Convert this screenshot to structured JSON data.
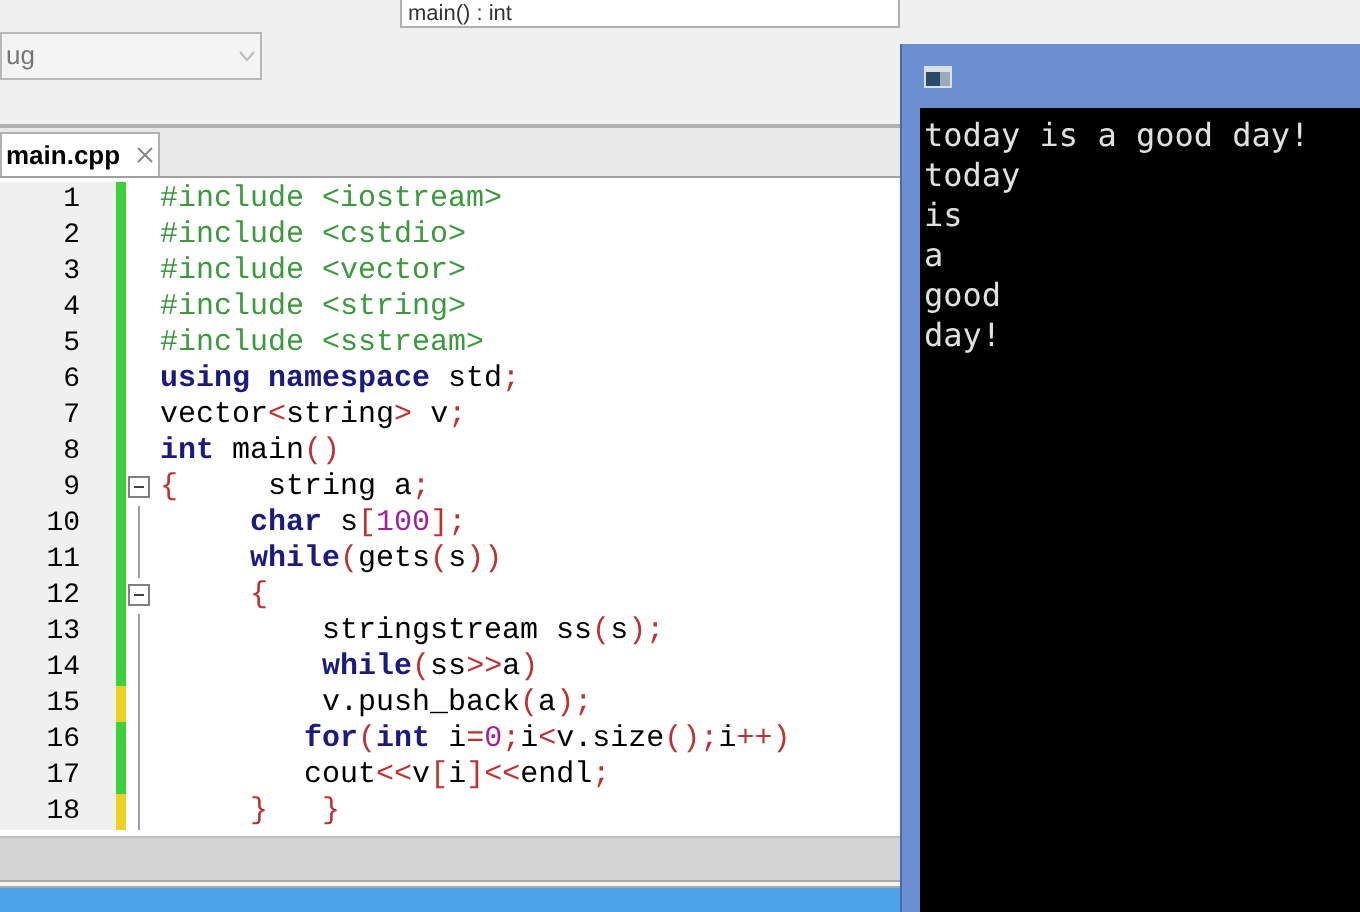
{
  "toolbar": {
    "build_target": "ug",
    "function_scope": "main() : int"
  },
  "tabs": [
    {
      "label": "main.cpp",
      "selected": true
    }
  ],
  "editor": {
    "lines": [
      {
        "number": "1",
        "unsaved": false,
        "fold_toggle": false,
        "in_fold": false,
        "tokens": [
          {
            "kind": "pp",
            "text": "#include <iostream>"
          }
        ]
      },
      {
        "number": "2",
        "unsaved": false,
        "fold_toggle": false,
        "in_fold": false,
        "tokens": [
          {
            "kind": "pp",
            "text": "#include <cstdio>"
          }
        ]
      },
      {
        "number": "3",
        "unsaved": false,
        "fold_toggle": false,
        "in_fold": false,
        "tokens": [
          {
            "kind": "pp",
            "text": "#include <vector>"
          }
        ]
      },
      {
        "number": "4",
        "unsaved": false,
        "fold_toggle": false,
        "in_fold": false,
        "tokens": [
          {
            "kind": "pp",
            "text": "#include <string>"
          }
        ]
      },
      {
        "number": "5",
        "unsaved": false,
        "fold_toggle": false,
        "in_fold": false,
        "tokens": [
          {
            "kind": "pp",
            "text": "#include <sstream>"
          }
        ]
      },
      {
        "number": "6",
        "unsaved": false,
        "fold_toggle": false,
        "in_fold": false,
        "tokens": [
          {
            "kind": "kw",
            "text": "using namespace"
          },
          {
            "kind": "plain",
            "text": " std"
          },
          {
            "kind": "op",
            "text": ";"
          }
        ]
      },
      {
        "number": "7",
        "unsaved": false,
        "fold_toggle": false,
        "in_fold": false,
        "tokens": [
          {
            "kind": "plain",
            "text": "vector"
          },
          {
            "kind": "op",
            "text": "<"
          },
          {
            "kind": "plain",
            "text": "string"
          },
          {
            "kind": "op",
            "text": ">"
          },
          {
            "kind": "plain",
            "text": " v"
          },
          {
            "kind": "op",
            "text": ";"
          }
        ]
      },
      {
        "number": "8",
        "unsaved": false,
        "fold_toggle": false,
        "in_fold": false,
        "tokens": [
          {
            "kind": "kw",
            "text": "int"
          },
          {
            "kind": "plain",
            "text": " main"
          },
          {
            "kind": "op",
            "text": "()"
          }
        ]
      },
      {
        "number": "9",
        "unsaved": false,
        "fold_toggle": true,
        "tokens": [
          {
            "kind": "op",
            "text": "{"
          },
          {
            "kind": "plain",
            "text": "     string a"
          },
          {
            "kind": "op",
            "text": ";"
          }
        ]
      },
      {
        "number": "10",
        "unsaved": false,
        "fold_toggle": false,
        "in_fold": true,
        "tokens": [
          {
            "kind": "kw",
            "text": "     char"
          },
          {
            "kind": "plain",
            "text": " s"
          },
          {
            "kind": "op",
            "text": "["
          },
          {
            "kind": "num",
            "text": "100"
          },
          {
            "kind": "op",
            "text": "];"
          }
        ]
      },
      {
        "number": "11",
        "unsaved": false,
        "fold_toggle": false,
        "in_fold": true,
        "tokens": [
          {
            "kind": "kw",
            "text": "     while"
          },
          {
            "kind": "op",
            "text": "("
          },
          {
            "kind": "plain",
            "text": "gets"
          },
          {
            "kind": "op",
            "text": "("
          },
          {
            "kind": "plain",
            "text": "s"
          },
          {
            "kind": "op",
            "text": "))"
          }
        ]
      },
      {
        "number": "12",
        "unsaved": false,
        "fold_toggle": true,
        "tokens": [
          {
            "kind": "op",
            "text": "     {"
          }
        ]
      },
      {
        "number": "13",
        "unsaved": false,
        "fold_toggle": false,
        "in_fold": true,
        "tokens": [
          {
            "kind": "plain",
            "text": "         stringstream ss"
          },
          {
            "kind": "op",
            "text": "("
          },
          {
            "kind": "plain",
            "text": "s"
          },
          {
            "kind": "op",
            "text": ");"
          }
        ]
      },
      {
        "number": "14",
        "unsaved": false,
        "fold_toggle": false,
        "in_fold": true,
        "tokens": [
          {
            "kind": "kw",
            "text": "         while"
          },
          {
            "kind": "op",
            "text": "("
          },
          {
            "kind": "plain",
            "text": "ss"
          },
          {
            "kind": "op",
            "text": ">>"
          },
          {
            "kind": "plain",
            "text": "a"
          },
          {
            "kind": "op",
            "text": ")"
          }
        ]
      },
      {
        "number": "15",
        "unsaved": true,
        "fold_toggle": false,
        "in_fold": true,
        "tokens": [
          {
            "kind": "plain",
            "text": "         v.push_back"
          },
          {
            "kind": "op",
            "text": "("
          },
          {
            "kind": "plain",
            "text": "a"
          },
          {
            "kind": "op",
            "text": ");"
          }
        ]
      },
      {
        "number": "16",
        "unsaved": false,
        "fold_toggle": false,
        "in_fold": true,
        "tokens": [
          {
            "kind": "kw",
            "text": "        for"
          },
          {
            "kind": "op",
            "text": "("
          },
          {
            "kind": "kw",
            "text": "int"
          },
          {
            "kind": "plain",
            "text": " i"
          },
          {
            "kind": "op",
            "text": "="
          },
          {
            "kind": "num",
            "text": "0"
          },
          {
            "kind": "op",
            "text": ";"
          },
          {
            "kind": "plain",
            "text": "i"
          },
          {
            "kind": "op",
            "text": "<"
          },
          {
            "kind": "plain",
            "text": "v.size"
          },
          {
            "kind": "op",
            "text": "();"
          },
          {
            "kind": "plain",
            "text": "i"
          },
          {
            "kind": "op",
            "text": "++)"
          }
        ]
      },
      {
        "number": "17",
        "unsaved": false,
        "fold_toggle": false,
        "in_fold": true,
        "tokens": [
          {
            "kind": "plain",
            "text": "        cout"
          },
          {
            "kind": "op",
            "text": "<<"
          },
          {
            "kind": "plain",
            "text": "v"
          },
          {
            "kind": "op",
            "text": "["
          },
          {
            "kind": "plain",
            "text": "i"
          },
          {
            "kind": "op",
            "text": "]<<"
          },
          {
            "kind": "plain",
            "text": "endl"
          },
          {
            "kind": "op",
            "text": ";"
          }
        ]
      },
      {
        "number": "18",
        "unsaved": true,
        "fold_toggle": false,
        "in_fold": true,
        "tokens": [
          {
            "kind": "op",
            "text": "     }"
          },
          {
            "kind": "op",
            "text": "   }"
          }
        ]
      }
    ]
  },
  "console": {
    "lines": [
      "today is a good day!",
      "today",
      "is",
      "a",
      "good",
      "day!"
    ]
  }
}
